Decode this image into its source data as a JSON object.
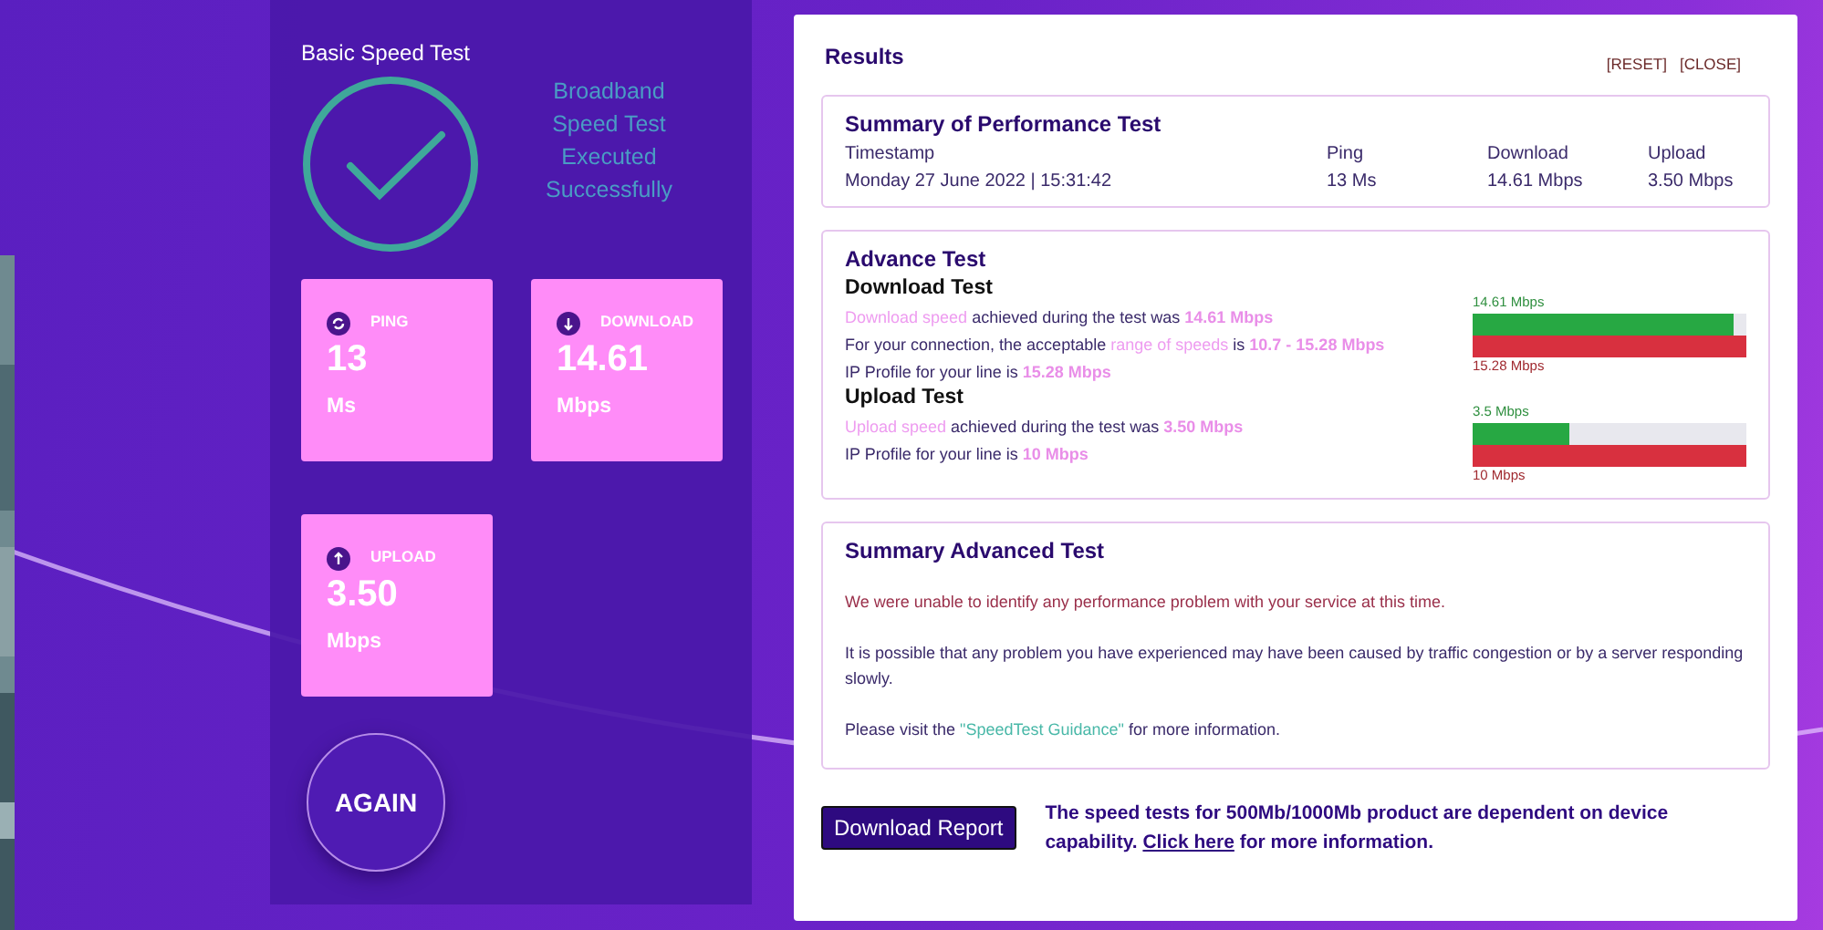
{
  "basic_test": {
    "title": "Basic Speed Test",
    "status_lines": [
      "Broadband",
      "Speed Test",
      "Executed",
      "Successfully"
    ],
    "tiles": [
      {
        "kind": "ping",
        "label": "PING",
        "value": "13",
        "unit": "Ms"
      },
      {
        "kind": "download",
        "label": "DOWNLOAD",
        "value": "14.61",
        "unit": "Mbps"
      },
      {
        "kind": "upload",
        "label": "UPLOAD",
        "value": "3.50",
        "unit": "Mbps"
      }
    ],
    "again_button": "AGAIN"
  },
  "results": {
    "title": "Results",
    "actions": [
      "[RESET]",
      "[CLOSE]"
    ],
    "summary": {
      "title": "Summary of Performance Test",
      "columns": [
        "Timestamp",
        "Ping",
        "Download",
        "Upload"
      ],
      "values": [
        "Monday 27 June 2022 | 15:31:42",
        "13 Ms",
        "14.61 Mbps",
        "3.50 Mbps"
      ]
    },
    "advance": {
      "title": "Advance Test",
      "sections": [
        {
          "heading": "Download Test",
          "lines": [
            [
              {
                "kind": "term",
                "text": "Download speed"
              },
              {
                "kind": "plain",
                "text": " achieved during the test was "
              },
              {
                "kind": "value",
                "text": "14.61 Mbps"
              }
            ],
            [
              {
                "kind": "plain",
                "text": "For your connection, the acceptable "
              },
              {
                "kind": "term",
                "text": "range of speeds"
              },
              {
                "kind": "plain",
                "text": " is "
              },
              {
                "kind": "value",
                "text": "10.7 - 15.28 Mbps"
              }
            ],
            [
              {
                "kind": "plain",
                "text": "IP Profile for your line is "
              },
              {
                "kind": "value",
                "text": "15.28 Mbps"
              }
            ]
          ],
          "bar": {
            "achieved_label": "14.61 Mbps",
            "level": 0.956,
            "profile_label": "15.28 Mbps"
          }
        },
        {
          "heading": "Upload Test",
          "lines": [
            [
              {
                "kind": "term",
                "text": "Upload speed"
              },
              {
                "kind": "plain",
                "text": " achieved during the test was "
              },
              {
                "kind": "value",
                "text": "3.50 Mbps"
              }
            ],
            [
              {
                "kind": "plain",
                "text": "IP Profile for your line is "
              },
              {
                "kind": "value",
                "text": "10 Mbps"
              }
            ]
          ],
          "bar": {
            "achieved_label": "3.5 Mbps",
            "level": 0.35,
            "profile_label": "10 Mbps"
          }
        }
      ]
    },
    "summary_advanced": {
      "title": "Summary Advanced Test",
      "paragraphs": [
        {
          "kind": "alert",
          "segments": [
            {
              "kind": "plain",
              "text": "We were unable to identify any performance problem with your service at this time."
            }
          ]
        },
        {
          "kind": "normal",
          "segments": [
            {
              "kind": "plain",
              "text": "It is possible that any problem you have experienced may have been caused by traffic congestion or by a server responding slowly."
            }
          ]
        },
        {
          "kind": "normal",
          "segments": [
            {
              "kind": "plain",
              "text": "Please visit the "
            },
            {
              "kind": "link",
              "text": "\"SpeedTest Guidance\""
            },
            {
              "kind": "plain",
              "text": " for more information."
            }
          ]
        }
      ]
    },
    "download_report_button": "Download Report",
    "note": [
      {
        "kind": "plain",
        "text": "The speed tests for 500Mb/1000Mb product are dependent on device capability. "
      },
      {
        "kind": "link",
        "text": "Click here"
      },
      {
        "kind": "plain",
        "text": " for more information."
      }
    ]
  }
}
